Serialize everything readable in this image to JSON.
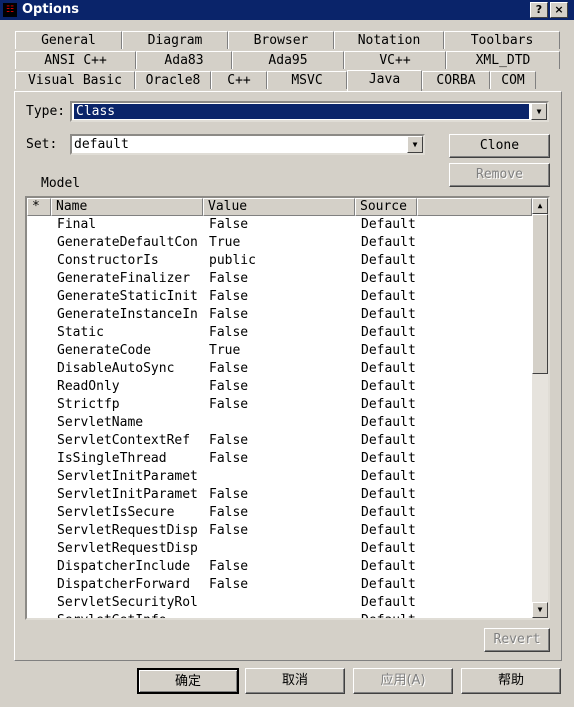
{
  "window": {
    "title": "Options",
    "help_glyph": "?",
    "close_glyph": "×",
    "icon_name": "rational-rose-app-icon"
  },
  "tabs_row1": [
    "General",
    "Diagram",
    "Browser",
    "Notation",
    "Toolbars"
  ],
  "tabs_row2": [
    "ANSI C++",
    "Ada83",
    "Ada95",
    "VC++",
    "XML_DTD"
  ],
  "tabs_row3": [
    "Visual Basic",
    "Oracle8",
    "C++",
    "MSVC",
    "Java",
    "CORBA",
    "COM"
  ],
  "active_tab": "Java",
  "type": {
    "label": "Type:",
    "value": "Class"
  },
  "set": {
    "label": "Set:",
    "value": "default"
  },
  "buttons": {
    "clone": "Clone",
    "remove": "Remove",
    "revert": "Revert"
  },
  "model_label": "Model",
  "grid": {
    "columns": [
      "*",
      "Name",
      "Value",
      "Source"
    ],
    "rows": [
      {
        "name": "Final",
        "value": "False",
        "source": "Default"
      },
      {
        "name": "GenerateDefaultCon",
        "value": "True",
        "source": "Default"
      },
      {
        "name": "ConstructorIs",
        "value": "public",
        "source": "Default"
      },
      {
        "name": "GenerateFinalizer",
        "value": "False",
        "source": "Default"
      },
      {
        "name": "GenerateStaticInit",
        "value": "False",
        "source": "Default"
      },
      {
        "name": "GenerateInstanceIn",
        "value": "False",
        "source": "Default"
      },
      {
        "name": "Static",
        "value": "False",
        "source": "Default"
      },
      {
        "name": "GenerateCode",
        "value": "True",
        "source": "Default"
      },
      {
        "name": "DisableAutoSync",
        "value": "False",
        "source": "Default"
      },
      {
        "name": "ReadOnly",
        "value": "False",
        "source": "Default"
      },
      {
        "name": "Strictfp",
        "value": "False",
        "source": "Default"
      },
      {
        "name": "ServletName",
        "value": "",
        "source": "Default"
      },
      {
        "name": "ServletContextRef",
        "value": "False",
        "source": "Default"
      },
      {
        "name": "IsSingleThread",
        "value": "False",
        "source": "Default"
      },
      {
        "name": "ServletInitParamet",
        "value": "",
        "source": "Default"
      },
      {
        "name": "ServletInitParamet",
        "value": "False",
        "source": "Default"
      },
      {
        "name": "ServletIsSecure",
        "value": "False",
        "source": "Default"
      },
      {
        "name": "ServletRequestDisp",
        "value": "False",
        "source": "Default"
      },
      {
        "name": "ServletRequestDisp",
        "value": "",
        "source": "Default"
      },
      {
        "name": "DispatcherInclude",
        "value": "False",
        "source": "Default"
      },
      {
        "name": "DispatcherForward",
        "value": "False",
        "source": "Default"
      },
      {
        "name": "ServletSecurityRol",
        "value": "",
        "source": "Default"
      },
      {
        "name": "ServletGetInfo",
        "value": "",
        "source": "Default"
      }
    ]
  },
  "footer": {
    "ok": "确定",
    "cancel": "取消",
    "apply": "应用(A)",
    "help": "帮助"
  }
}
